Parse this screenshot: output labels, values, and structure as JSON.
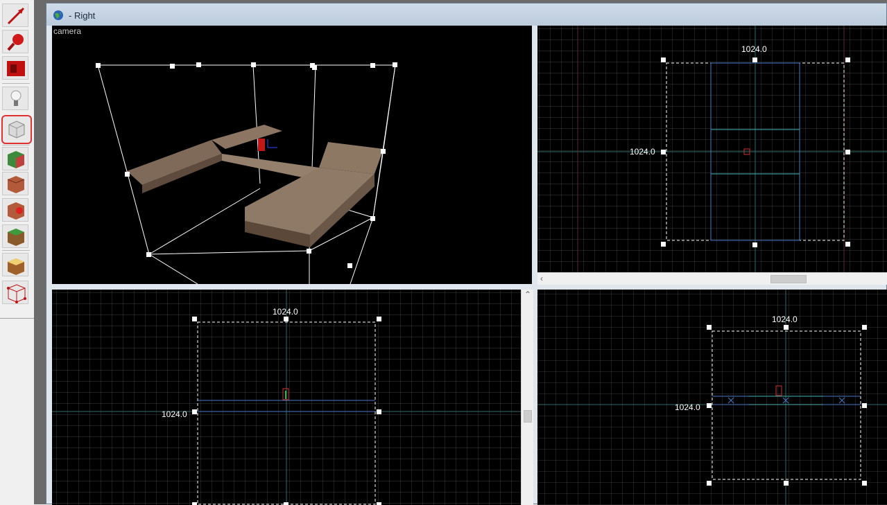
{
  "window": {
    "title": "- Right"
  },
  "toolbar": {
    "tools": [
      {
        "name": "selection-tool-icon"
      },
      {
        "name": "magnify-tool-icon"
      },
      {
        "name": "camera-tool-icon"
      },
      {
        "name": "entity-tool-icon"
      },
      {
        "name": "block-tool-icon",
        "highlighted": true
      },
      {
        "name": "texture-application-icon"
      },
      {
        "name": "apply-current-texture-icon"
      },
      {
        "name": "decal-tool-icon"
      },
      {
        "name": "overlay-tool-icon"
      },
      {
        "name": "clipping-tool-icon"
      },
      {
        "name": "vertex-tool-icon"
      }
    ]
  },
  "viewports": {
    "camera": {
      "label": "camera"
    },
    "top": {
      "width_label": "1024.0",
      "height_label": "1024.0"
    },
    "front": {
      "width_label": "1024.0",
      "height_label": "1024.0"
    },
    "side": {
      "width_label": "1024.0",
      "height_label": "1024.0"
    }
  },
  "colors": {
    "grid": "#3a3a3a",
    "axis": "#2f6b6b",
    "selection": "#ffffff",
    "brush_outline": "#4a78c8",
    "annotation": "#e02020"
  }
}
